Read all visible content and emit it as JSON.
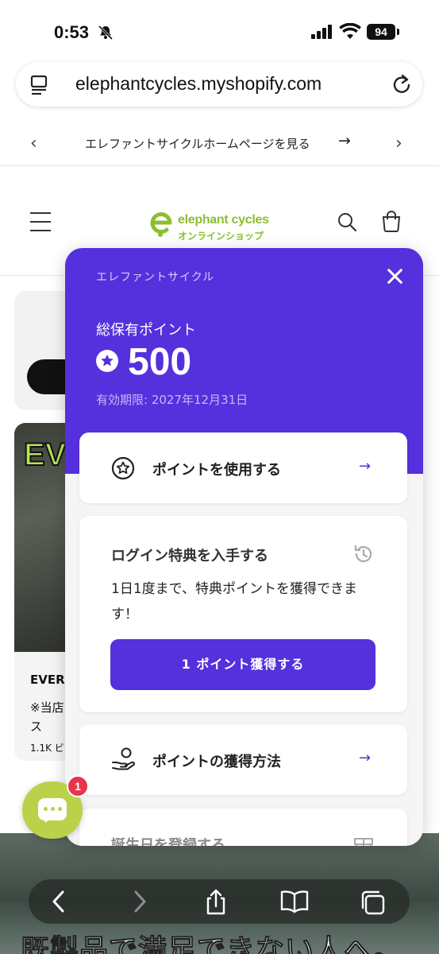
{
  "status": {
    "time": "0:53",
    "battery": "94"
  },
  "browser": {
    "url": "elephantcycles.myshopify.com"
  },
  "announcement": {
    "text": "エレファントサイクルホームページを見る",
    "arrow": "→"
  },
  "header": {
    "logo_en": "elephant cycles",
    "logo_jp": "オンラインショップ"
  },
  "background": {
    "card_title": "EVER",
    "card_text": "※当店 ん。ス",
    "card_meta": "1.1K ビ",
    "photo_text": "EV",
    "bottom_banner": "既製品で満足できない人へ。"
  },
  "chat": {
    "badge": "1"
  },
  "rewards": {
    "brand": "エレファントサイクル",
    "balance_label": "総保有ポイント",
    "points": "500",
    "expiry": "有効期限: 2027年12月31日",
    "use_points": {
      "label": "ポイントを使用する",
      "arrow": "→"
    },
    "login_bonus": {
      "title": "ログイン特典を入手する",
      "description": "1日1度まで、特典ポイントを獲得できます！",
      "button": "1 ポイント獲得する"
    },
    "earn": {
      "label": "ポイントの獲得方法",
      "arrow": "→"
    },
    "birthday": {
      "title": "誕生日を登録する"
    }
  },
  "colors": {
    "brand_purple": "#5431dd",
    "logo_green": "#8cbf2e",
    "chat_green": "#b9d24a",
    "badge_red": "#e5364b"
  }
}
